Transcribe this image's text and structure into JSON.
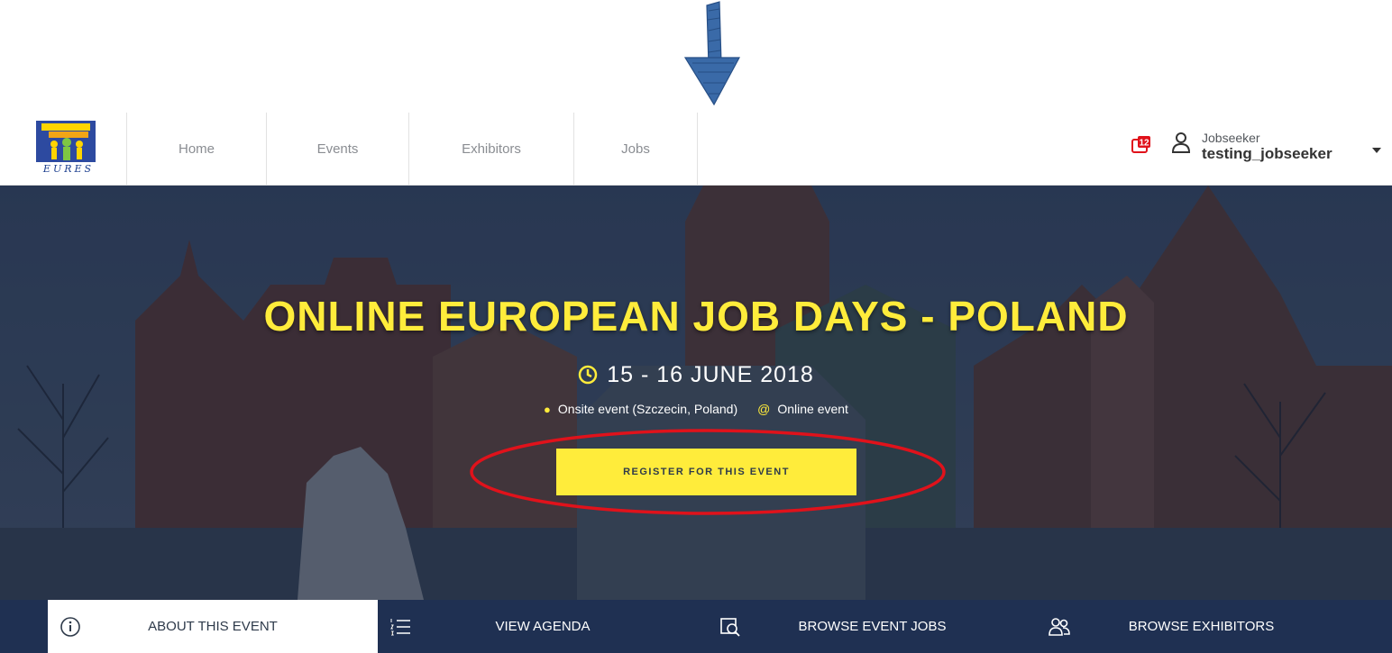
{
  "navbar": {
    "logo_text": "EURES",
    "items": [
      {
        "label": "Home"
      },
      {
        "label": "Events"
      },
      {
        "label": "Exhibitors"
      },
      {
        "label": "Jobs"
      }
    ],
    "notification_count": "12",
    "user": {
      "role": "Jobseeker",
      "username": "testing_jobseeker"
    }
  },
  "hero": {
    "title": "ONLINE EUROPEAN JOB DAYS - POLAND",
    "date": "15 - 16 JUNE 2018",
    "location_onsite": "Onsite event (Szczecin, Poland)",
    "location_online": "Online event",
    "register_label": "REGISTER FOR THIS EVENT"
  },
  "tabs": [
    {
      "label": "ABOUT THIS EVENT",
      "icon": "info-icon",
      "active": true
    },
    {
      "label": "VIEW AGENDA",
      "icon": "numbered-list-icon",
      "active": false
    },
    {
      "label": "BROWSE EVENT JOBS",
      "icon": "job-search-icon",
      "active": false
    },
    {
      "label": "BROWSE EXHIBITORS",
      "icon": "people-icon",
      "active": false
    }
  ],
  "colors": {
    "accent_yellow": "#ffec3b",
    "navy": "#1f3052",
    "annotation_red": "#e0121b",
    "annotation_blue": "#2f5e99"
  }
}
